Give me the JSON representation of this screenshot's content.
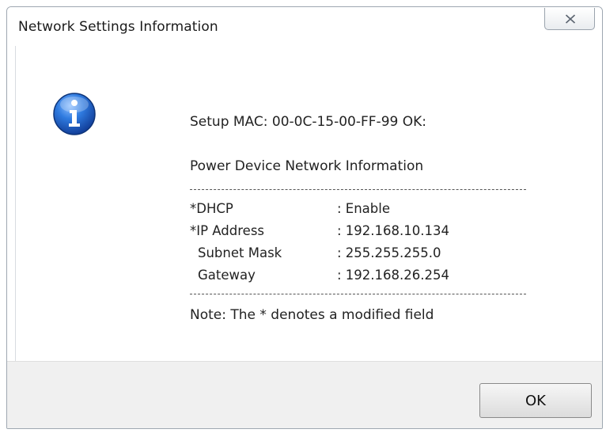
{
  "window": {
    "title": "Network Settings Information",
    "close_glyph": "✕"
  },
  "message": {
    "setup_line": "Setup MAC: 00-0C-15-00-FF-99  OK:",
    "heading": "Power Device Network Information",
    "rows": [
      {
        "label": "*DHCP",
        "value": ": Enable"
      },
      {
        "label": "*IP Address",
        "value": ": 192.168.10.134"
      },
      {
        "label": "Subnet Mask",
        "value": ": 255.255.255.0"
      },
      {
        "label": "Gateway",
        "value": ": 192.168.26.254"
      }
    ],
    "note": "Note: The * denotes a modified field"
  },
  "buttons": {
    "ok_label": "OK"
  },
  "icons": {
    "dialog_icon": "info-icon",
    "close_icon": "close-icon"
  },
  "colors": {
    "info_icon_blue": "#1f63c6",
    "footer_bg": "#f0f0f0"
  }
}
